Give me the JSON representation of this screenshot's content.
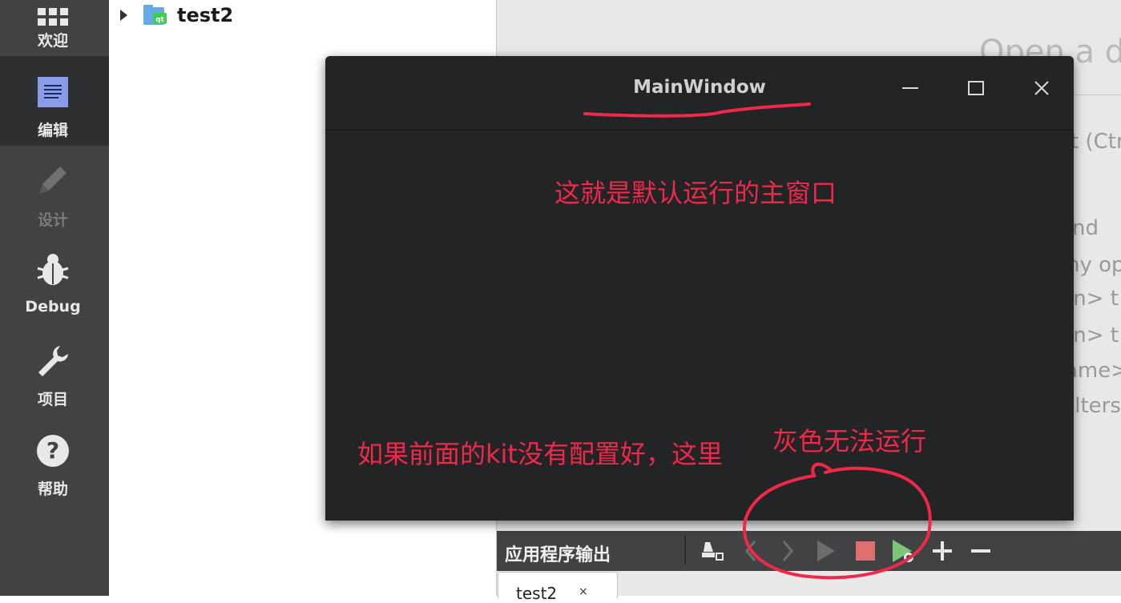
{
  "sidebar": {
    "items": [
      {
        "label": "欢迎",
        "icon": "grid-icon"
      },
      {
        "label": "编辑",
        "icon": "document-icon"
      },
      {
        "label": "设计",
        "icon": "pencil-icon"
      },
      {
        "label": "Debug",
        "icon": "bug-icon"
      },
      {
        "label": "项目",
        "icon": "wrench-icon"
      },
      {
        "label": "帮助",
        "icon": "help-icon"
      }
    ]
  },
  "tree": {
    "project_name": "test2",
    "icon": "qt-project-icon"
  },
  "editor": {
    "open_title": "Open a do",
    "hints": [
      "t (Ctr",
      "nd",
      "ny op",
      "rn> t",
      "rn> t",
      "ame>",
      "ilters"
    ]
  },
  "app_window": {
    "title": "MainWindow"
  },
  "annotations": {
    "main_window_note": "这就是默认运行的主窗口",
    "kit_note": "如果前面的kit没有配置好，这里",
    "gray_note": "灰色无法运行"
  },
  "output": {
    "title": "应用程序输出",
    "tab_label": "test2",
    "tab_close": "×"
  },
  "colors": {
    "annotation": "#f0284a",
    "sidebar": "#404244",
    "accent_icon": "#8a9be8"
  }
}
